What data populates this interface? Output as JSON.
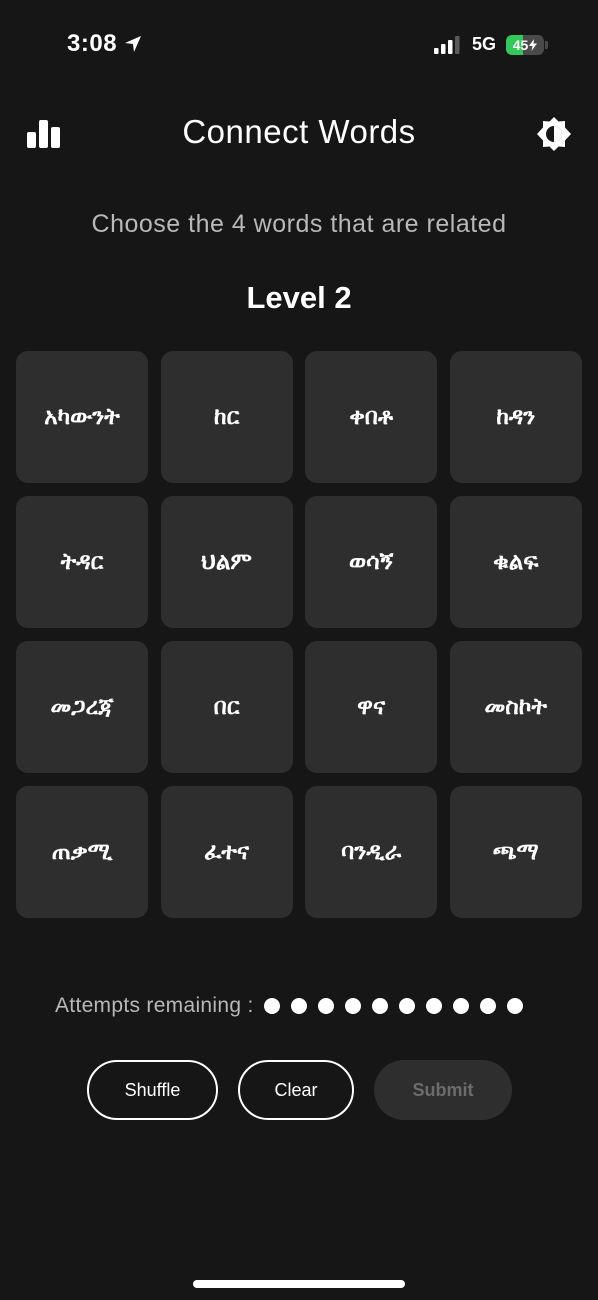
{
  "status_bar": {
    "time": "3:08",
    "network": "5G",
    "battery_level": "45",
    "battery_fraction": 0.45,
    "battery_color": "#34c759"
  },
  "header": {
    "title": "Connect Words",
    "left_icon": "bar-chart-icon",
    "right_icon": "brightness-icon"
  },
  "instruction": "Choose the 4 words that are related",
  "level": "Level 2",
  "words": [
    "አካውንት",
    "ከር",
    "ቀበቶ",
    "ከዳን",
    "ትዳር",
    "ህልም",
    "ወሳኝ",
    "ቁልፍ",
    "መጋረጃ",
    "በር",
    "ዋና",
    "መስኮት",
    "ጠቃሚ",
    "ፈተና",
    "ባንዲራ",
    "ጫማ"
  ],
  "attempts": {
    "label": "Attempts remaining :",
    "remaining": 10
  },
  "actions": {
    "shuffle": "Shuffle",
    "clear": "Clear",
    "submit": "Submit"
  },
  "colors": {
    "background": "#161616",
    "tile": "#2e2e2e",
    "muted_text": "#b8b8b8",
    "disabled_text": "#6c6c6c"
  }
}
